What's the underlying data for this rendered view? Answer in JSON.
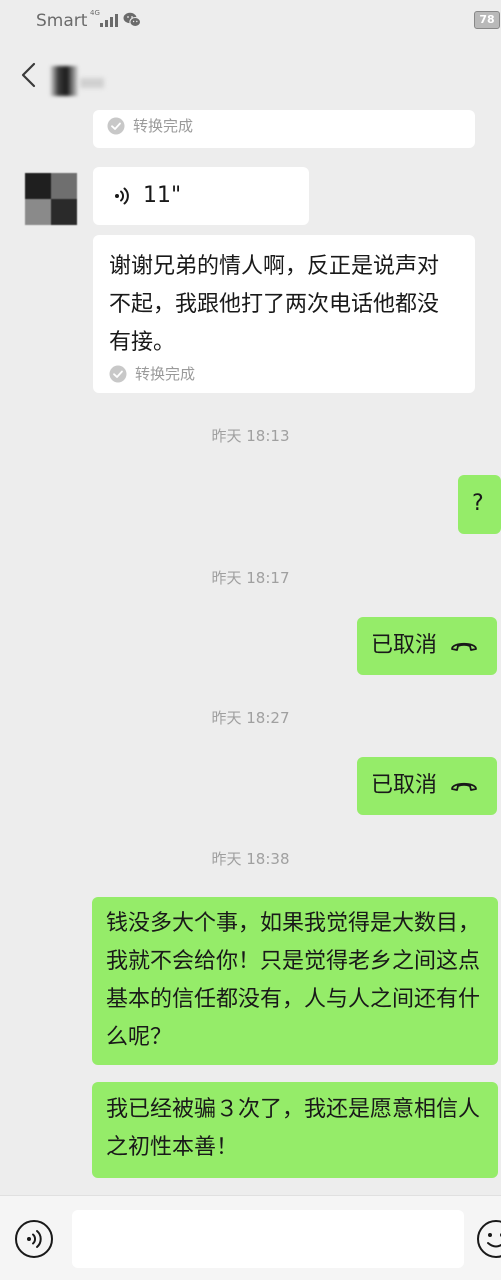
{
  "status_bar": {
    "carrier": "Smart",
    "network": "4G",
    "battery": "78"
  },
  "messages": {
    "m1_status": "转换完成",
    "m2_duration": "11\"",
    "m3_text": "谢谢兄弟的情人啊，反正是说声对不起，我跟他打了两次电话他都没有接。",
    "m3_status": "转换完成",
    "t1": "昨天 18:13",
    "m4_text": "?",
    "t2": "昨天 18:17",
    "m5_text": "已取消",
    "t3": "昨天 18:27",
    "m6_text": "已取消",
    "t4": "昨天 18:38",
    "m7_text": "钱没多大个事，如果我觉得是大数目，我就不会给你！只是觉得老乡之间这点基本的信任都没有，人与人之间还有什么呢？",
    "m8_text": "我已经被骗３次了，我还是愿意相信人之初性本善！"
  },
  "icons": {
    "back": "back-arrow-icon",
    "check": "check-circle-icon",
    "voice": "voice-wave-icon",
    "hangup": "hangup-phone-icon",
    "voice_toggle": "voice-input-icon",
    "emoji": "emoji-icon"
  },
  "colors": {
    "background": "#ededed",
    "incoming_bubble": "#ffffff",
    "outgoing_bubble": "#95ec69",
    "timestamp": "#a0a0a0"
  }
}
